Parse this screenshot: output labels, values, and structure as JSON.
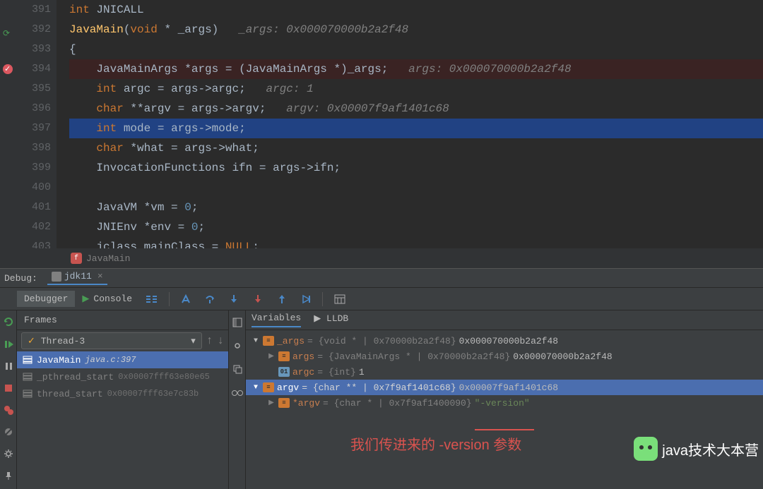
{
  "editor": {
    "lines": [
      {
        "num": "391",
        "html": "<span class='kw'>int</span> <span class='id'>JNICALL</span>"
      },
      {
        "num": "392",
        "html": "<span class='fn'>JavaMain</span><span class='punc'>(</span><span class='kw'>void</span> <span class='punc'>*</span> <span class='id'>_args</span><span class='punc'>)</span>   <span class='com'>_args: 0x000070000b2a2f48</span>",
        "sync": true
      },
      {
        "num": "393",
        "html": "<span class='punc'>{</span>"
      },
      {
        "num": "394",
        "html": "    <span class='id'>JavaMainArgs</span> <span class='punc'>*</span><span class='id'>args</span> <span class='punc'>=</span> <span class='punc'>(</span><span class='id'>JavaMainArgs</span> <span class='punc'>*)</span><span class='id'>_args</span><span class='punc'>;</span>   <span class='com'>args: 0x000070000b2a2f48</span>",
        "bp": true
      },
      {
        "num": "395",
        "html": "    <span class='kw'>int</span> <span class='id'>argc</span> <span class='punc'>=</span> <span class='id'>args</span><span class='punc'>-&gt;</span><span class='id'>argc</span><span class='punc'>;</span>   <span class='com'>argc: 1</span>"
      },
      {
        "num": "396",
        "html": "    <span class='kw'>char</span> <span class='punc'>**</span><span class='id'>argv</span> <span class='punc'>=</span> <span class='id'>args</span><span class='punc'>-&gt;</span><span class='id'>argv</span><span class='punc'>;</span>   <span class='com'>argv: 0x00007f9af1401c68</span>"
      },
      {
        "num": "397",
        "html": "    <span class='kw'>int</span> <span class='id'>mode</span> <span class='punc'>=</span> <span class='id'>args</span><span class='punc'>-&gt;</span><span class='id'>mode</span><span class='punc'>;</span>",
        "cur": true
      },
      {
        "num": "398",
        "html": "    <span class='kw'>char</span> <span class='punc'>*</span><span class='id'>what</span> <span class='punc'>=</span> <span class='id'>args</span><span class='punc'>-&gt;</span><span class='id'>what</span><span class='punc'>;</span>"
      },
      {
        "num": "399",
        "html": "    <span class='id'>InvocationFunctions</span> <span class='id'>ifn</span> <span class='punc'>=</span> <span class='id'>args</span><span class='punc'>-&gt;</span><span class='id'>ifn</span><span class='punc'>;</span>"
      },
      {
        "num": "400",
        "html": ""
      },
      {
        "num": "401",
        "html": "    <span class='id'>JavaVM</span> <span class='punc'>*</span><span class='id'>vm</span> <span class='punc'>=</span> <span class='num'>0</span><span class='punc'>;</span>"
      },
      {
        "num": "402",
        "html": "    <span class='id'>JNIEnv</span> <span class='punc'>*</span><span class='id'>env</span> <span class='punc'>=</span> <span class='num'>0</span><span class='punc'>;</span>"
      },
      {
        "num": "403",
        "html": "    <span class='id'>jclass</span> <span class='id'>mainClass</span> <span class='punc'>=</span> <span class='kw'>NULL</span><span class='punc'>;</span>",
        "fade": true
      }
    ],
    "crumb": "JavaMain"
  },
  "debug": {
    "title": "Debug:",
    "run_config": "jdk11",
    "tabs": {
      "debugger": "Debugger",
      "console": "Console"
    }
  },
  "frames": {
    "header": "Frames",
    "thread": "Thread-3",
    "items": [
      {
        "label": "JavaMain",
        "loc": "java.c:397",
        "sel": true
      },
      {
        "label": "_pthread_start",
        "addr": "0x00007fff63e80e65"
      },
      {
        "label": "thread_start",
        "addr": "0x00007fff63e7c83b"
      }
    ]
  },
  "vars": {
    "tabs": {
      "variables": "Variables",
      "lldb": "LLDB"
    },
    "rows": [
      {
        "indent": 0,
        "arrow": "down",
        "ico": "struct",
        "name": "_args",
        "type": " = {void * | 0x70000b2a2f48}",
        "val": " 0x000070000b2a2f48"
      },
      {
        "indent": 1,
        "arrow": "right",
        "ico": "struct",
        "name": "args",
        "type": " = {JavaMainArgs * | 0x70000b2a2f48}",
        "val": " 0x000070000b2a2f48"
      },
      {
        "indent": 1,
        "arrow": "",
        "ico": "prim",
        "name": "argc",
        "type": " = {int}",
        "val": " 1"
      },
      {
        "indent": 0,
        "arrow": "down",
        "ico": "struct",
        "name": "argv",
        "type": " = {char ** | 0x7f9af1401c68}",
        "val": " 0x00007f9af1401c68",
        "sel": true
      },
      {
        "indent": 1,
        "arrow": "right",
        "ico": "struct",
        "name": "*argv",
        "type": " = {char * | 0x7f9af1400090}",
        "str": " \"-version\""
      }
    ]
  },
  "annotation": "我们传进来的 -version 参数",
  "watermark": "java技术大本营"
}
